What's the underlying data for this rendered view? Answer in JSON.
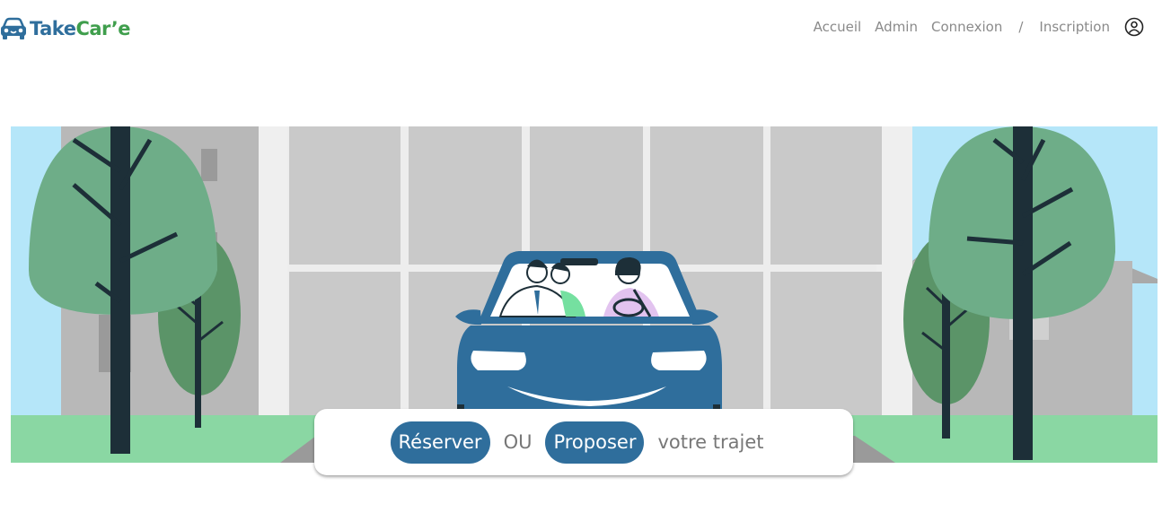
{
  "brand": {
    "part1": "Take",
    "part2": "Car’e",
    "icon": "car-icon",
    "primary_color": "#2f6e9c",
    "secondary_color": "#3f9e4c"
  },
  "nav": {
    "items": [
      "Accueil",
      "Admin",
      "Connexion"
    ],
    "separator": "/",
    "signup": "Inscription",
    "account_icon": "user-circle-icon"
  },
  "hero": {
    "illustration": "car-with-three-passengers-illustration"
  },
  "cta": {
    "reserve": "Réserver",
    "or": "OU",
    "propose": "Proposer",
    "suffix": "votre trajet"
  }
}
